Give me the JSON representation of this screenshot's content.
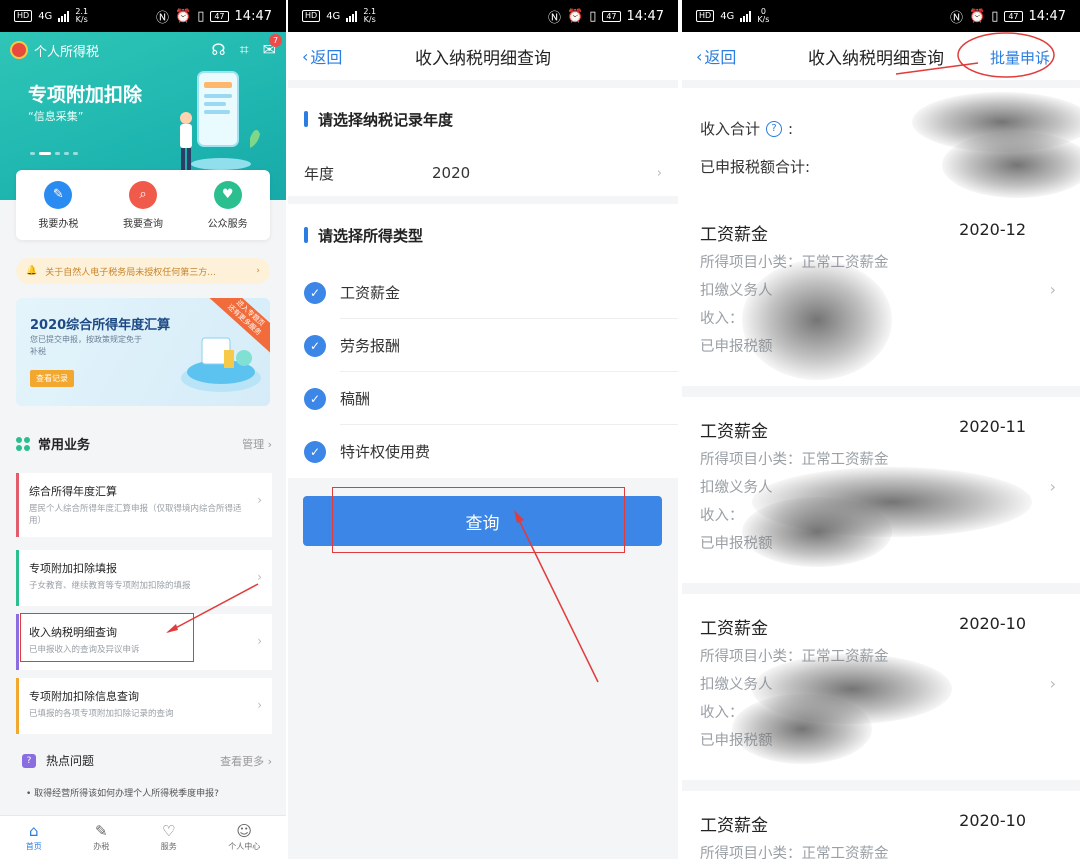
{
  "status": {
    "p1": {
      "hd": "HD",
      "net": "4G",
      "speed_top": "2.1",
      "speed_unit": "K/s",
      "battery": "47",
      "time": "14:47"
    },
    "p2": {
      "hd": "HD",
      "net": "4G",
      "speed_top": "2.1",
      "speed_unit": "K/s",
      "battery": "47",
      "time": "14:47"
    },
    "p3": {
      "hd": "HD",
      "net": "4G",
      "speed_top": "0",
      "speed_unit": "K/s",
      "battery": "47",
      "time": "14:47"
    }
  },
  "home": {
    "app_title": "个人所得税",
    "badge": "7",
    "hero_title": "专项附加扣除",
    "hero_sub": "“信息采集”",
    "quick": [
      {
        "label": "我要办税",
        "color": "#2a8cf0",
        "glyph": "✎"
      },
      {
        "label": "我要查询",
        "color": "#f05a4a",
        "glyph": "⌕"
      },
      {
        "label": "公众服务",
        "color": "#2bbf8f",
        "glyph": "♥"
      }
    ],
    "notice": "关于自然人电子税务局未授权任何第三方...",
    "banner": {
      "title": "2020综合所得年度汇算",
      "sub": "您已提交申报，按政策规定免于补税",
      "btn": "查看记录",
      "ribbon_line1": "进入专题页",
      "ribbon_line2": "还有更多服务"
    },
    "common": {
      "title": "常用业务",
      "manage": "管理"
    },
    "items": [
      {
        "title": "综合所得年度汇算",
        "sub": "居民个人综合所得年度汇算申报（仅取得境内综合所得适用）",
        "color": "#e25d6b"
      },
      {
        "title": "专项附加扣除填报",
        "sub": "子女教育、继续教育等专项附加扣除的填报",
        "color": "#2bbf8f"
      },
      {
        "title": "收入纳税明细查询",
        "sub": "已申报收入的查询及异议申诉",
        "color": "#8a6de0"
      },
      {
        "title": "专项附加扣除信息查询",
        "sub": "已填报的各项专项附加扣除记录的查询",
        "color": "#f2a72f"
      }
    ],
    "hot": {
      "title": "热点问题",
      "more": "查看更多",
      "q": "• 取得经营所得该如何办理个人所得税季度申报?"
    },
    "tabs": [
      {
        "label": "首页",
        "glyph": "⌂"
      },
      {
        "label": "办税",
        "glyph": "✎"
      },
      {
        "label": "服务",
        "glyph": "♡"
      },
      {
        "label": "个人中心",
        "glyph": "☺"
      }
    ]
  },
  "query": {
    "back": "返回",
    "title": "收入纳税明细查询",
    "year_section": "请选择纳税记录年度",
    "year_label": "年度",
    "year_value": "2020",
    "type_section": "请选择所得类型",
    "types": [
      "工资薪金",
      "劳务报酬",
      "稿酬",
      "特许权使用费"
    ],
    "button": "查询"
  },
  "result": {
    "back": "返回",
    "title": "收入纳税明细查询",
    "batch": "批量申诉",
    "income_total": "收入合计",
    "tax_total": "已申报税额合计:",
    "cards": [
      {
        "type": "工资薪金",
        "date": "2020-12",
        "sub": "所得项目小类：正常工资薪金",
        "l2": "扣缴义务人",
        "l3": "收入：",
        "l4": "已申报税额"
      },
      {
        "type": "工资薪金",
        "date": "2020-11",
        "sub": "所得项目小类：正常工资薪金",
        "l2": "扣缴义务人",
        "l3": "收入：",
        "l4": "已申报税额"
      },
      {
        "type": "工资薪金",
        "date": "2020-10",
        "sub": "所得项目小类：正常工资薪金",
        "l2": "扣缴义务人",
        "l3": "收入：",
        "l4": "已申报税额"
      },
      {
        "type": "工资薪金",
        "date": "2020-10",
        "sub": "所得项目小类：正常工资薪金"
      }
    ]
  }
}
